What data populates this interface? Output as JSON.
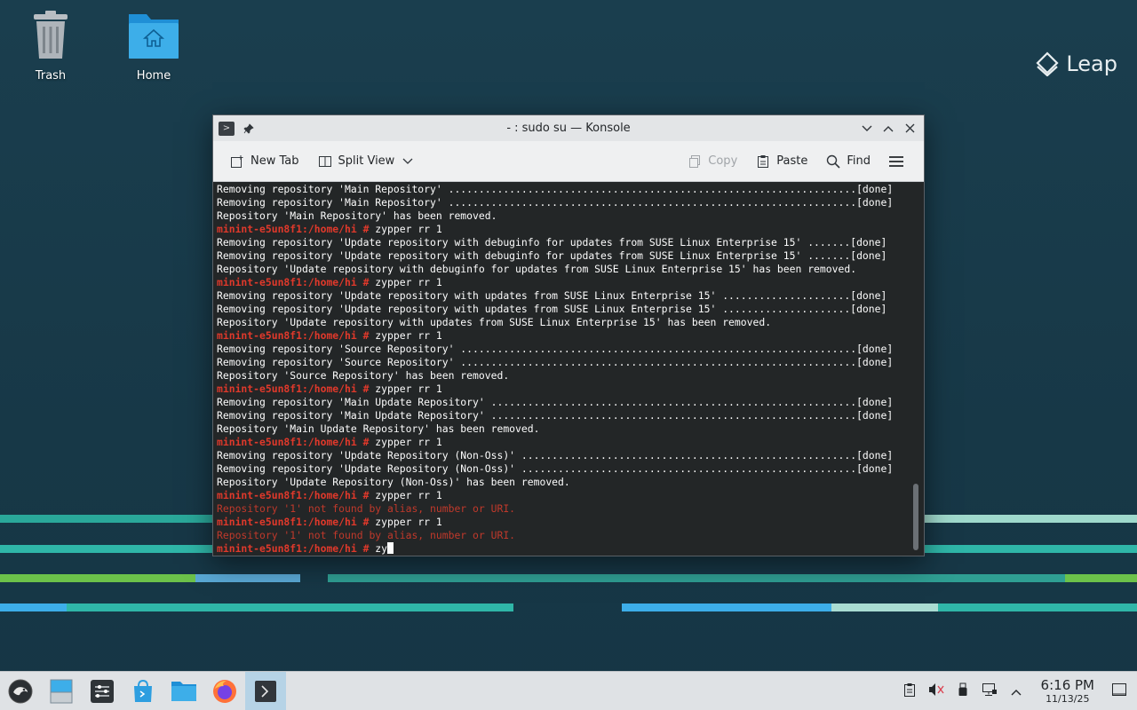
{
  "desktop": {
    "icons": [
      {
        "label": "Trash"
      },
      {
        "label": "Home"
      }
    ],
    "brand": "Leap"
  },
  "window": {
    "title": "- : sudo su — Konsole",
    "toolbar": {
      "new_tab": "New Tab",
      "split_view": "Split View",
      "copy": "Copy",
      "paste": "Paste",
      "find": "Find"
    },
    "terminal": {
      "lines": [
        {
          "t": "out",
          "text": "Removing repository 'Main Repository' ...................................................................[done]"
        },
        {
          "t": "out",
          "text": "Removing repository 'Main Repository' ...................................................................[done]"
        },
        {
          "t": "out",
          "text": "Repository 'Main Repository' has been removed."
        },
        {
          "t": "cmd",
          "prompt": "minint-e5un8f1:/home/hi #",
          "text": " zypper rr 1"
        },
        {
          "t": "out",
          "text": "Removing repository 'Update repository with debuginfo for updates from SUSE Linux Enterprise 15' .......[done]"
        },
        {
          "t": "out",
          "text": "Removing repository 'Update repository with debuginfo for updates from SUSE Linux Enterprise 15' .......[done]"
        },
        {
          "t": "out",
          "text": "Repository 'Update repository with debuginfo for updates from SUSE Linux Enterprise 15' has been removed."
        },
        {
          "t": "cmd",
          "prompt": "minint-e5un8f1:/home/hi #",
          "text": " zypper rr 1"
        },
        {
          "t": "out",
          "text": "Removing repository 'Update repository with updates from SUSE Linux Enterprise 15' .....................[done]"
        },
        {
          "t": "out",
          "text": "Removing repository 'Update repository with updates from SUSE Linux Enterprise 15' .....................[done]"
        },
        {
          "t": "out",
          "text": "Repository 'Update repository with updates from SUSE Linux Enterprise 15' has been removed."
        },
        {
          "t": "cmd",
          "prompt": "minint-e5un8f1:/home/hi #",
          "text": " zypper rr 1"
        },
        {
          "t": "out",
          "text": "Removing repository 'Source Repository' .................................................................[done]"
        },
        {
          "t": "out",
          "text": "Removing repository 'Source Repository' .................................................................[done]"
        },
        {
          "t": "out",
          "text": "Repository 'Source Repository' has been removed."
        },
        {
          "t": "cmd",
          "prompt": "minint-e5un8f1:/home/hi #",
          "text": " zypper rr 1"
        },
        {
          "t": "out",
          "text": "Removing repository 'Main Update Repository' ............................................................[done]"
        },
        {
          "t": "out",
          "text": "Removing repository 'Main Update Repository' ............................................................[done]"
        },
        {
          "t": "out",
          "text": "Repository 'Main Update Repository' has been removed."
        },
        {
          "t": "cmd",
          "prompt": "minint-e5un8f1:/home/hi #",
          "text": " zypper rr 1"
        },
        {
          "t": "out",
          "text": "Removing repository 'Update Repository (Non-Oss)' .......................................................[done]"
        },
        {
          "t": "out",
          "text": "Removing repository 'Update Repository (Non-Oss)' .......................................................[done]"
        },
        {
          "t": "out",
          "text": "Repository 'Update Repository (Non-Oss)' has been removed."
        },
        {
          "t": "cmd",
          "prompt": "minint-e5un8f1:/home/hi #",
          "text": " zypper rr 1"
        },
        {
          "t": "err",
          "text": "Repository '1' not found by alias, number or URI."
        },
        {
          "t": "cmd",
          "prompt": "minint-e5un8f1:/home/hi #",
          "text": " zypper rr 1"
        },
        {
          "t": "err",
          "text": "Repository '1' not found by alias, number or URI."
        },
        {
          "t": "input",
          "prompt": "minint-e5un8f1:/home/hi #",
          "text": " zy"
        }
      ]
    }
  },
  "taskbar": {
    "clock_time": "6:16 PM",
    "clock_date": "11/13/25"
  },
  "colors": {
    "terminal_bg": "#232627",
    "prompt": "#e0392b",
    "error": "#c0392b",
    "accent": "#3daee9"
  }
}
